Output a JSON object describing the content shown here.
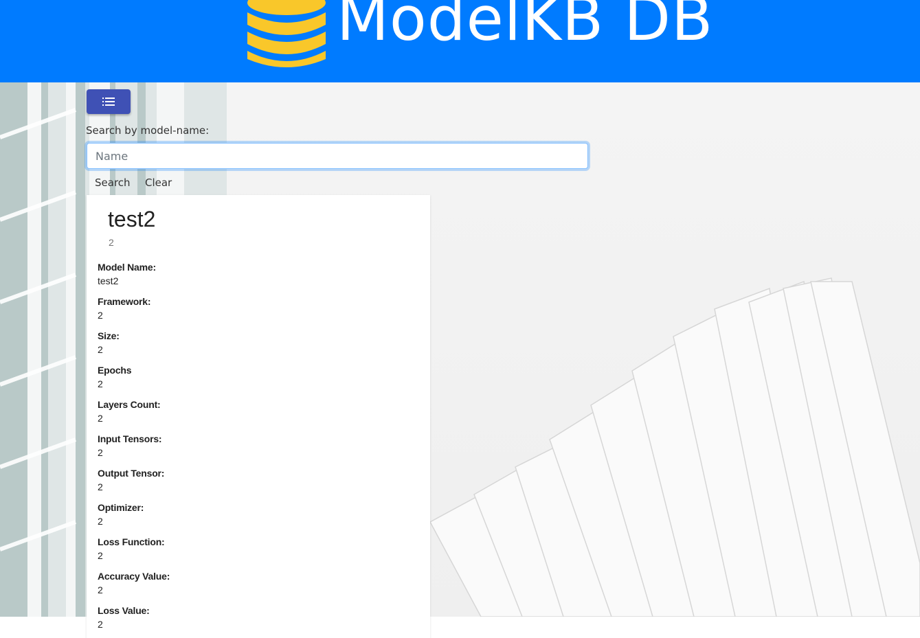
{
  "header": {
    "title": "ModelKB DB",
    "logo_icon": "database-icon",
    "bg_color": "#007bff",
    "logo_color": "#f9c72a"
  },
  "toolbar": {
    "menu_icon": "list-icon",
    "menu_color": "#3f51b5"
  },
  "search": {
    "label": "Search by model-name:",
    "placeholder": "Name",
    "value": "",
    "search_label": "Search",
    "clear_label": "Clear"
  },
  "card": {
    "title": "test2",
    "subtitle": "2",
    "fields": [
      {
        "label": "Model Name:",
        "value": "test2"
      },
      {
        "label": "Framework:",
        "value": "2"
      },
      {
        "label": "Size:",
        "value": "2"
      },
      {
        "label": "Epochs",
        "value": "2"
      },
      {
        "label": "Layers Count:",
        "value": "2"
      },
      {
        "label": "Input Tensors:",
        "value": "2"
      },
      {
        "label": "Output Tensor:",
        "value": "2"
      },
      {
        "label": "Optimizer:",
        "value": "2"
      },
      {
        "label": "Loss Function:",
        "value": "2"
      },
      {
        "label": "Accuracy Value:",
        "value": "2"
      },
      {
        "label": "Loss Value:",
        "value": "2"
      }
    ]
  }
}
